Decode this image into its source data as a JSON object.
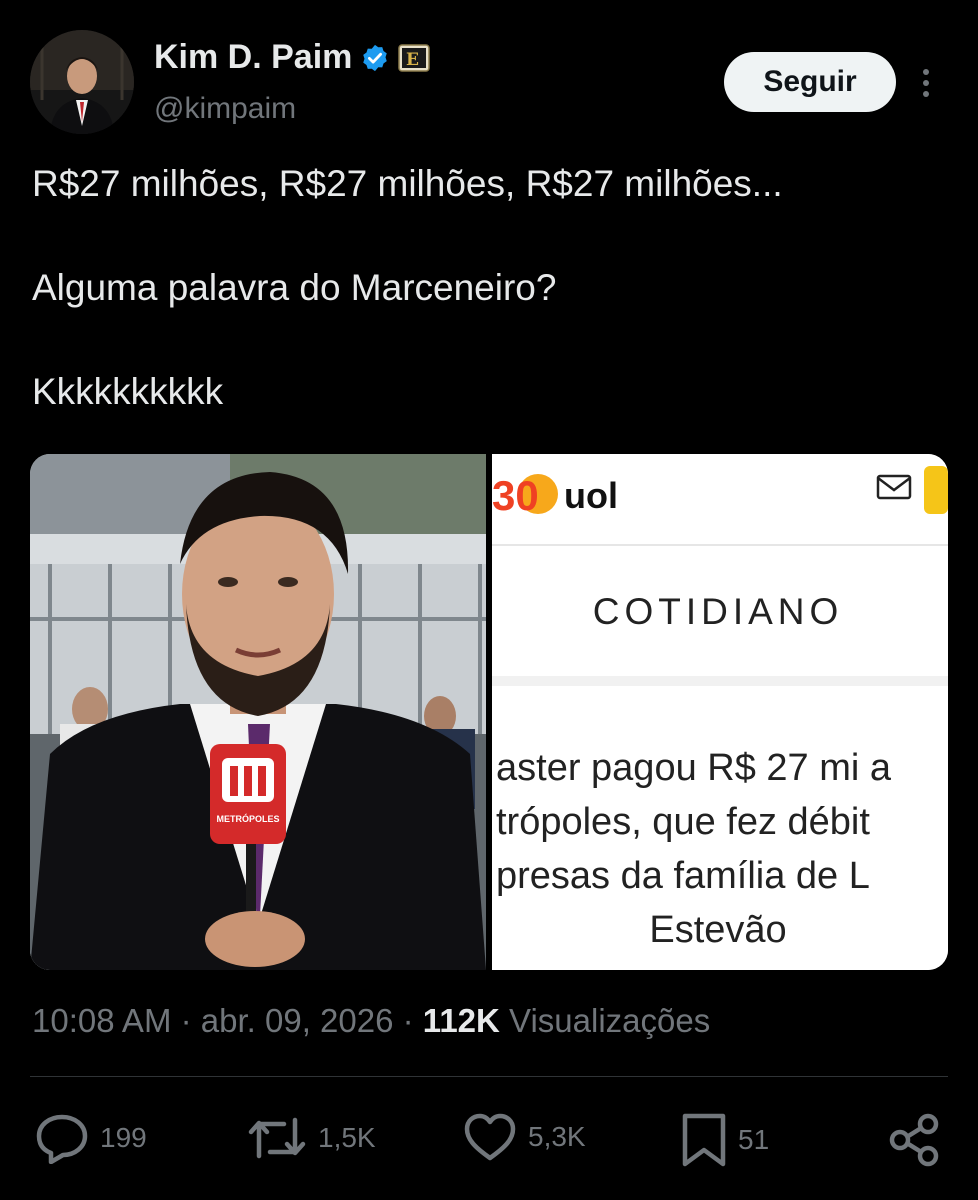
{
  "author": {
    "name": "Kim D. Paim",
    "handle": "@kimpaim",
    "verified_color": "#1d9bf0"
  },
  "follow_label": "Seguir",
  "tweet": {
    "line1": "R$27 milhões, R$27 milhões, R$27 milhões...",
    "line2": "Alguma palavra do Marceneiro?",
    "line3": "Kkkkkkkkkk"
  },
  "media": {
    "mic_brand": "METRÓPOLES",
    "article": {
      "brand_number": "30",
      "brand": "uol",
      "section": "COTIDIANO",
      "headline_lines": [
        "aster pagou R$ 27 mi a",
        "trópoles, que fez débit",
        "presas da família de L",
        "Estevão"
      ]
    }
  },
  "meta": {
    "time": "10:08 AM",
    "sep1": "·",
    "date": "abr. 09, 2026",
    "sep2": "·",
    "views": "112K",
    "views_label": "Visualizações"
  },
  "actions": {
    "replies": "199",
    "reposts": "1,5K",
    "likes": "5,3K",
    "bookmarks": "51"
  },
  "icons": [
    "reply-icon",
    "repost-icon",
    "like-icon",
    "bookmark-icon",
    "share-icon",
    "mail-icon",
    "more-icon",
    "verified-icon",
    "affiliate-badge-icon"
  ]
}
